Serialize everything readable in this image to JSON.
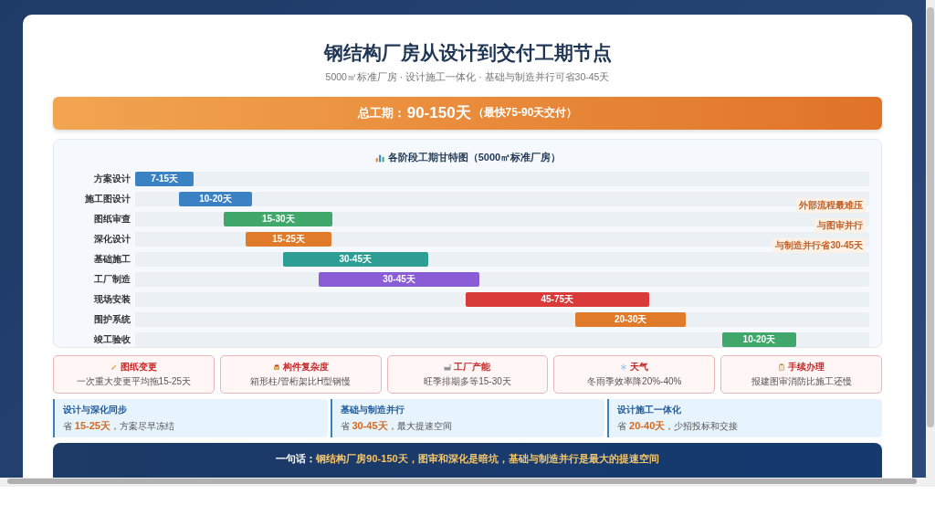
{
  "title": "钢结构厂房从设计到交付工期节点",
  "subtitle": "5000㎡标准厂房 · 设计施工一体化 · 基础与制造并行可省30-45天",
  "total": {
    "label": "总工期：",
    "value": "90-150天",
    "note": "（最快75-90天交付）"
  },
  "gantt": {
    "title": "各阶段工期甘特图（5000㎡标准厂房）",
    "rows": [
      {
        "label": "方案设计",
        "duration": "7-15天",
        "color": "#3b82c4"
      },
      {
        "label": "施工图设计",
        "duration": "10-20天",
        "color": "#3b82c4"
      },
      {
        "label": "图纸审查",
        "duration": "15-30天",
        "color": "#3fa86a"
      },
      {
        "label": "深化设计",
        "duration": "15-25天",
        "color": "#e07b2c"
      },
      {
        "label": "基础施工",
        "duration": "30-45天",
        "color": "#2e9e94"
      },
      {
        "label": "工厂制造",
        "duration": "30-45天",
        "color": "#8a5cd6"
      },
      {
        "label": "现场安装",
        "duration": "45-75天",
        "color": "#d93a3a"
      },
      {
        "label": "围护系统",
        "duration": "20-30天",
        "color": "#e07b2c"
      },
      {
        "label": "竣工验收",
        "duration": "10-20天",
        "color": "#3fa86a"
      }
    ],
    "notes": [
      "外部流程最难压",
      "与图审并行",
      "与制造并行省30-45天"
    ]
  },
  "risks": [
    {
      "kind": "pencil",
      "title": "图纸变更",
      "text": "一次重大变更平均拖15-25天"
    },
    {
      "kind": "crane",
      "title": "构件复杂度",
      "text": "箱形柱/管桁架比H型钢慢"
    },
    {
      "kind": "factory",
      "title": "工厂产能",
      "text": "旺季排期多等15-30天"
    },
    {
      "kind": "snow",
      "title": "天气",
      "text": "冬雨季效率降20%-40%"
    },
    {
      "kind": "clipboard",
      "title": "手续办理",
      "text": "报建图审消防比施工还慢"
    }
  ],
  "tips": [
    {
      "title": "设计与深化同步",
      "text": "省 **15-25天**，方案尽早冻结"
    },
    {
      "title": "基础与制造并行",
      "text": "省 **30-45天**，最大提速空间"
    },
    {
      "title": "设计施工一体化",
      "text": "省 **20-40天**，少招投标和交接"
    }
  ],
  "summary": {
    "lead": "一句话：",
    "text": "钢结构厂房90-150天，图审和深化是暗坑，基础与制造并行是最大的提速空间"
  }
}
